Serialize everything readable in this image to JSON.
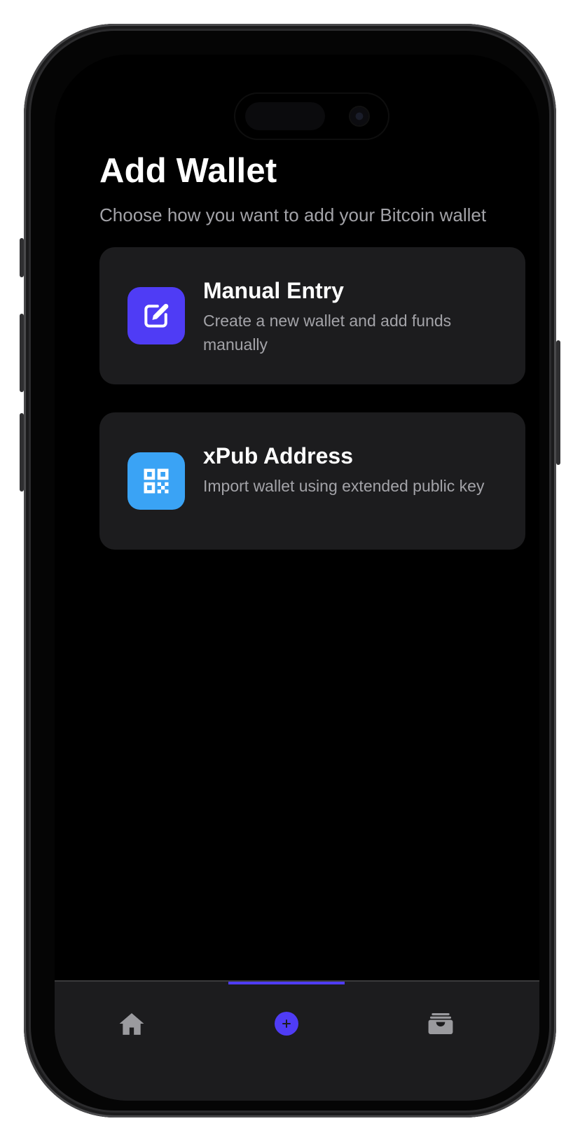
{
  "header": {
    "title": "Add Wallet",
    "subtitle": "Choose how you want to add your Bitcoin wallet"
  },
  "options": [
    {
      "title": "Manual Entry",
      "description": "Create a new wallet and add funds manually",
      "icon": "edit-icon",
      "color": "#4f3cf5"
    },
    {
      "title": "xPub Address",
      "description": "Import wallet using extended public key",
      "icon": "qr-code-icon",
      "color": "#3aa3f5"
    }
  ],
  "tabbar": {
    "tabs": [
      {
        "icon": "home-icon",
        "active": false
      },
      {
        "icon": "add-circle-icon",
        "active": true
      },
      {
        "icon": "wallet-icon",
        "active": false
      }
    ],
    "accent": "#4f3cf5"
  }
}
